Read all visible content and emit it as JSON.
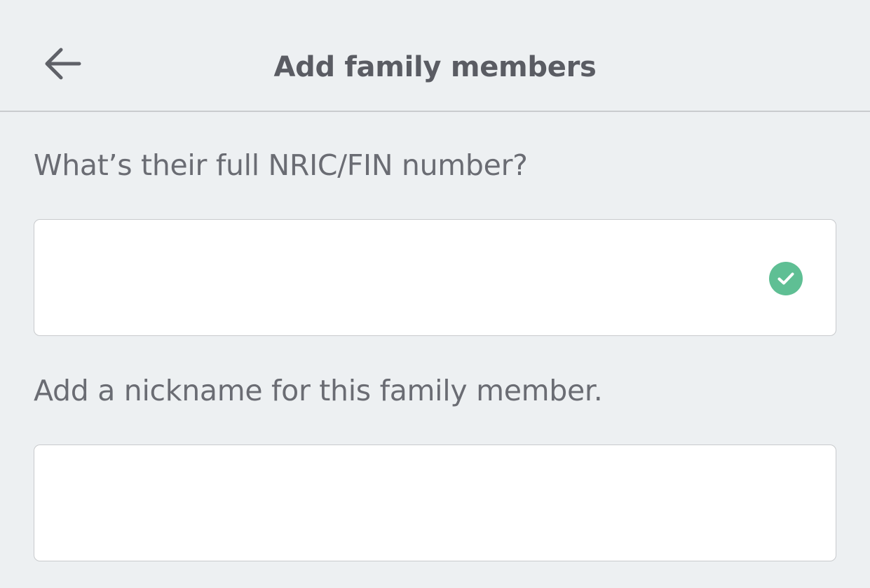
{
  "header": {
    "title": "Add family members",
    "back_icon": "arrow-left-icon"
  },
  "form": {
    "nric": {
      "label": "What’s their full NRIC/FIN number?",
      "value": "",
      "placeholder": "",
      "status_icon": "check-circle-icon",
      "status_color": "#5fbf94"
    },
    "nickname": {
      "label": "Add a nickname for this family member.",
      "value": "",
      "placeholder": ""
    }
  },
  "colors": {
    "background": "#edf0f2",
    "text": "#5d5f66",
    "field_border": "#c8cacd",
    "divider": "#c9cbce"
  }
}
